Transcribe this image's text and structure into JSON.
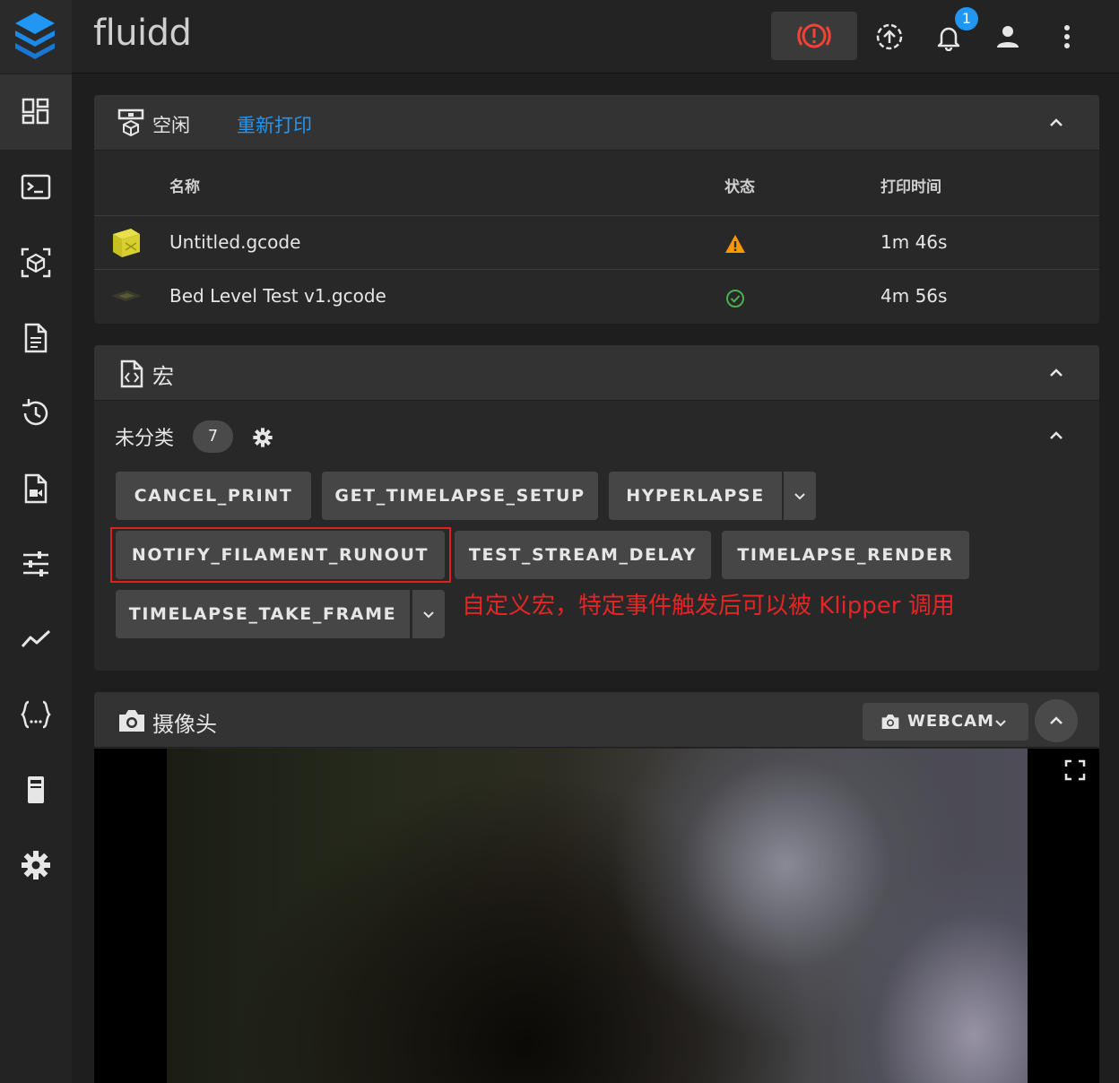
{
  "app": {
    "title": "fluidd",
    "notification_count": "1"
  },
  "colors": {
    "accent": "#2196f3",
    "estop": "#f44336",
    "warning": "#ff9800",
    "success": "#4caf50",
    "annotation": "#e52525"
  },
  "nav": {
    "items": [
      {
        "icon": "dashboard-icon"
      },
      {
        "icon": "console-icon"
      },
      {
        "icon": "cube-scan-icon"
      },
      {
        "icon": "file-document-icon"
      },
      {
        "icon": "history-icon"
      },
      {
        "icon": "file-video-icon"
      },
      {
        "icon": "tune-icon"
      },
      {
        "icon": "chart-line-icon"
      },
      {
        "icon": "code-braces-icon"
      },
      {
        "icon": "printer-device-icon"
      },
      {
        "icon": "settings-icon"
      }
    ]
  },
  "status_card": {
    "state": "空闲",
    "reprint_link": "重新打印",
    "columns": {
      "name": "名称",
      "status": "状态",
      "time": "打印时间"
    },
    "rows": [
      {
        "name": "Untitled.gcode",
        "status_icon": "alert-icon",
        "time": "1m 46s"
      },
      {
        "name": "Bed Level Test v1.gcode",
        "status_icon": "check-circle-icon",
        "time": "4m 56s"
      }
    ]
  },
  "macros_card": {
    "title": "宏",
    "category": "未分类",
    "category_count": "7",
    "buttons": [
      "CANCEL_PRINT",
      "GET_TIMELAPSE_SETUP",
      "HYPERLAPSE",
      "NOTIFY_FILAMENT_RUNOUT",
      "TEST_STREAM_DELAY",
      "TIMELAPSE_RENDER",
      "TIMELAPSE_TAKE_FRAME"
    ],
    "annotation": "自定义宏，特定事件触发后可以被 Klipper 调用"
  },
  "camera_card": {
    "title": "摄像头",
    "webcam_select": "WEBCAM"
  }
}
